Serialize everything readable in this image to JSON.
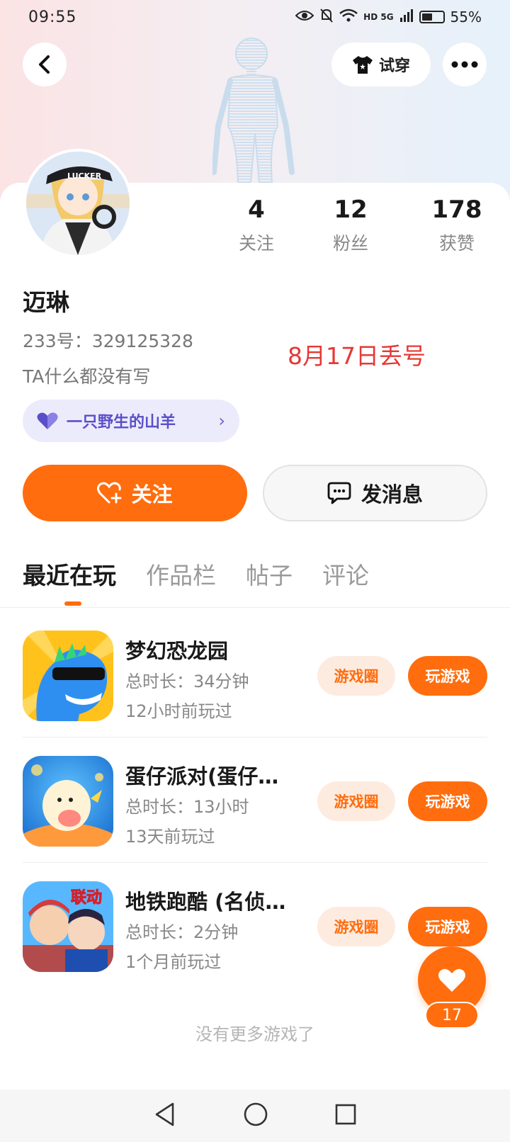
{
  "status_bar": {
    "time": "09:55",
    "network": "HD 5G",
    "battery": "55%"
  },
  "header": {
    "try_on_label": "试穿"
  },
  "profile": {
    "name": "迈琳",
    "uid": "233号：329125328",
    "bio": "TA什么都没有写",
    "overlay_note": "8月17日丢号",
    "tag_label": "一只野生的山羊",
    "stats": [
      {
        "value": "4",
        "label": "关注"
      },
      {
        "value": "12",
        "label": "粉丝"
      },
      {
        "value": "178",
        "label": "获赞"
      }
    ]
  },
  "actions": {
    "follow_label": "关注",
    "message_label": "发消息"
  },
  "tabs": [
    {
      "label": "最近在玩",
      "active": true
    },
    {
      "label": "作品栏",
      "active": false
    },
    {
      "label": "帖子",
      "active": false
    },
    {
      "label": "评论",
      "active": false
    }
  ],
  "games": [
    {
      "title": "梦幻恐龙园",
      "duration": "总时长：34分钟",
      "last_played": "12小时前玩过",
      "circle_label": "游戏圈",
      "play_label": "玩游戏"
    },
    {
      "title": "蛋仔派对(蛋仔…",
      "duration": "总时长：13小时",
      "last_played": "13天前玩过",
      "circle_label": "游戏圈",
      "play_label": "玩游戏"
    },
    {
      "title": "地铁跑酷 (名侦…",
      "duration": "总时长：2分钟",
      "last_played": "1个月前玩过",
      "circle_label": "游戏圈",
      "play_label": "玩游戏"
    }
  ],
  "game_icon_text": {
    "subway_badge": "联动"
  },
  "avatar_cap_text": "LUCKER",
  "like_fab": {
    "count": "17"
  },
  "footer_text": "没有更多游戏了",
  "colors": {
    "accent": "#ff6d0e",
    "tag_bg": "#ecebfb",
    "tag_text": "#5a4fc9",
    "note_red": "#e53935"
  }
}
